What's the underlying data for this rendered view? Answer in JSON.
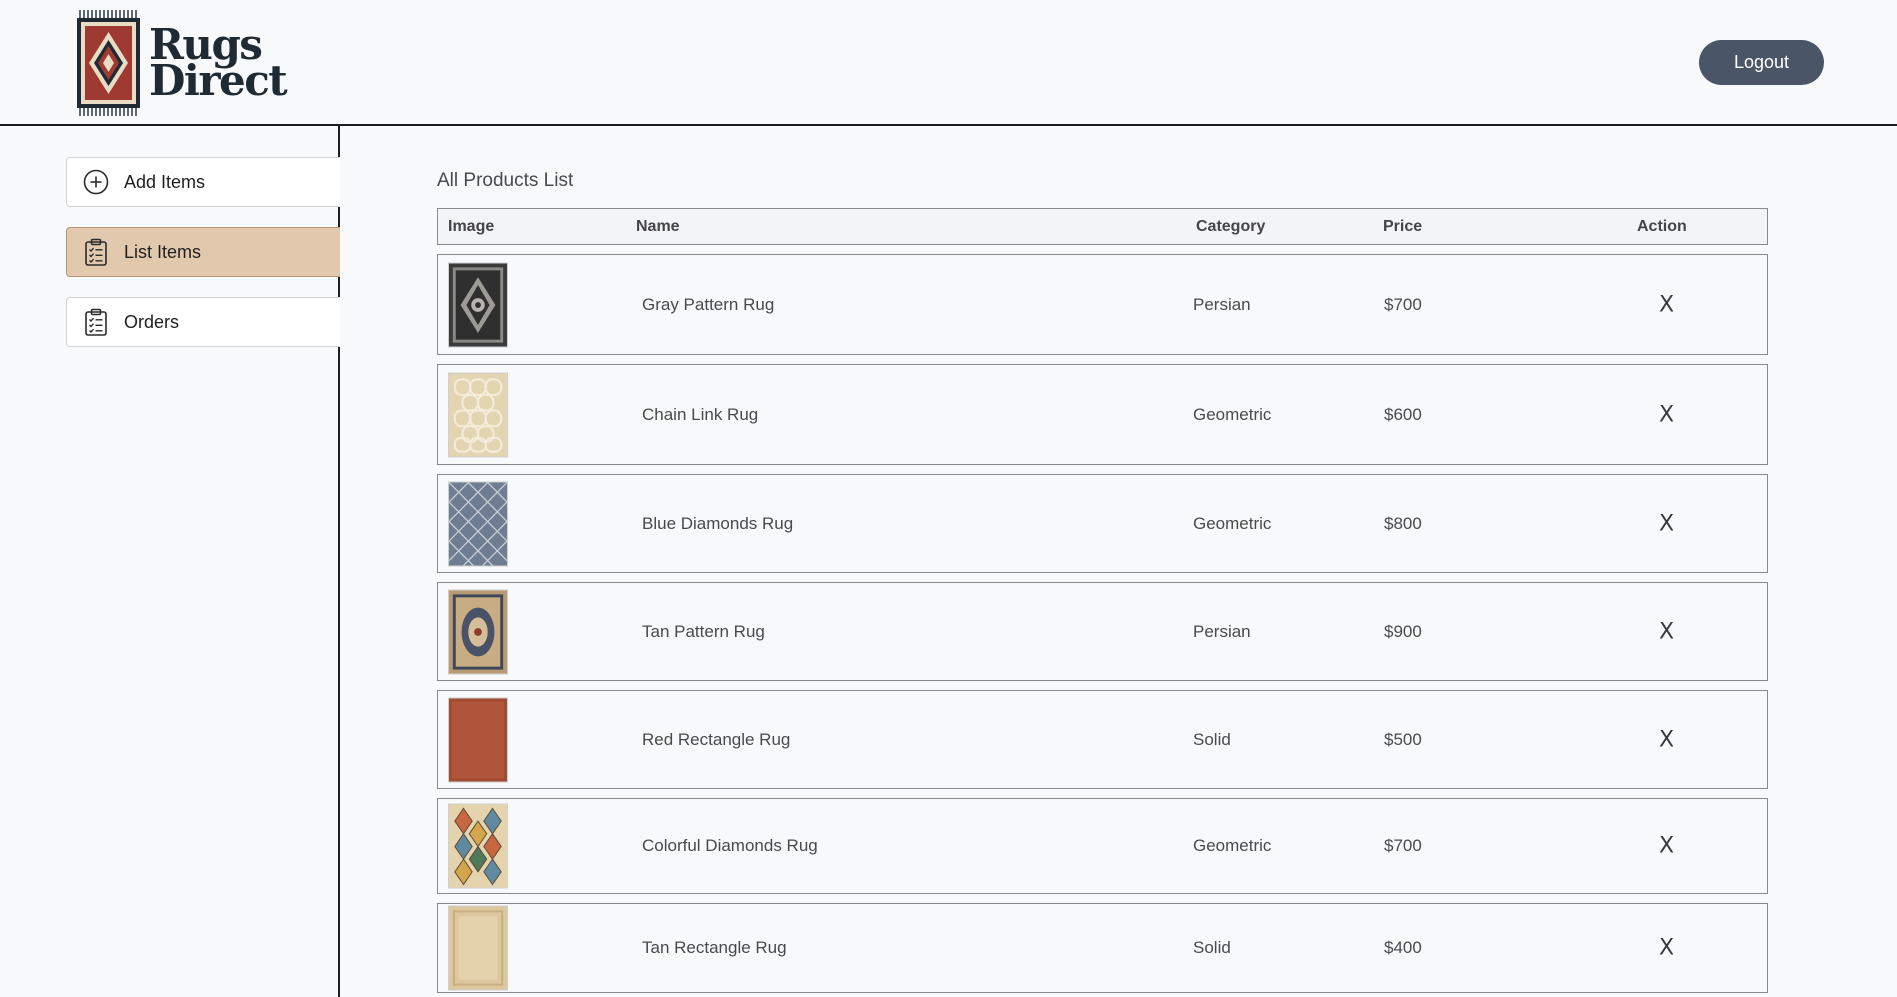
{
  "brand": {
    "line1": "Rugs",
    "line2": "Direct"
  },
  "header": {
    "logout_label": "Logout"
  },
  "sidebar": {
    "items": [
      {
        "label": "Add Items",
        "icon": "plus-circle-icon",
        "active": false
      },
      {
        "label": "List Items",
        "icon": "clipboard-list-icon",
        "active": true
      },
      {
        "label": "Orders",
        "icon": "clipboard-list-icon",
        "active": false
      }
    ]
  },
  "main": {
    "title": "All Products List",
    "columns": [
      "Image",
      "Name",
      "Category",
      "Price",
      "Action"
    ],
    "products": [
      {
        "name": "Gray Pattern Rug",
        "category": "Persian",
        "price": "$700",
        "action": "X",
        "image": "gray-pattern-rug-thumbnail"
      },
      {
        "name": "Chain Link Rug",
        "category": "Geometric",
        "price": "$600",
        "action": "X",
        "image": "chain-link-rug-thumbnail"
      },
      {
        "name": "Blue Diamonds Rug",
        "category": "Geometric",
        "price": "$800",
        "action": "X",
        "image": "blue-diamonds-rug-thumbnail"
      },
      {
        "name": "Tan Pattern Rug",
        "category": "Persian",
        "price": "$900",
        "action": "X",
        "image": "tan-pattern-rug-thumbnail"
      },
      {
        "name": "Red Rectangle Rug",
        "category": "Solid",
        "price": "$500",
        "action": "X",
        "image": "red-rectangle-rug-thumbnail"
      },
      {
        "name": "Colorful Diamonds Rug",
        "category": "Geometric",
        "price": "$700",
        "action": "X",
        "image": "colorful-diamonds-rug-thumbnail"
      },
      {
        "name": "Tan Rectangle Rug",
        "category": "Solid",
        "price": "$400",
        "action": "X",
        "image": "tan-rectangle-rug-thumbnail"
      }
    ]
  },
  "colors": {
    "accent_active": "#e2c9ae",
    "logout_bg": "#4a5568",
    "logo_red": "#9e3a32"
  }
}
